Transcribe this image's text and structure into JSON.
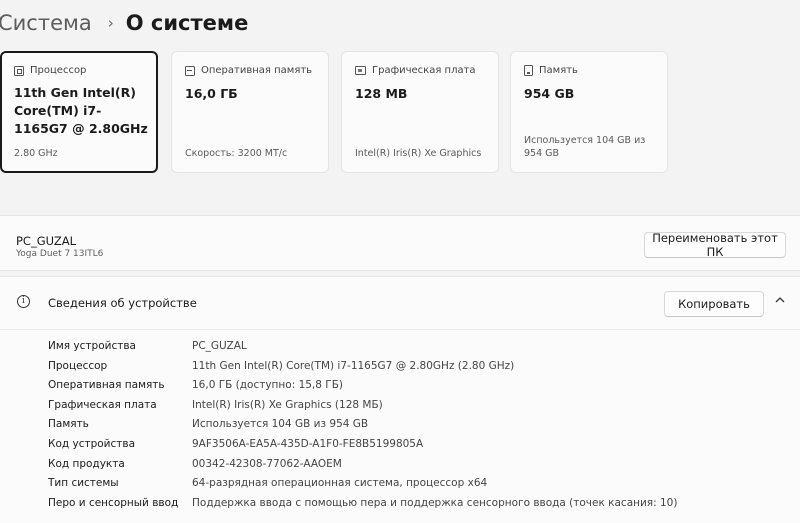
{
  "breadcrumb": {
    "parent": "Система",
    "separator": "›",
    "current": "О системе"
  },
  "cards": [
    {
      "icon": "cpu-icon",
      "title": "Процессор",
      "value": "11th Gen Intel(R) Core(TM) i7-1165G7 @ 2.80GHz",
      "sub": "2.80 GHz"
    },
    {
      "icon": "ram-icon",
      "title": "Оперативная память",
      "value": "16,0 ГБ",
      "sub": "Скорость: 3200 МТ/с"
    },
    {
      "icon": "gpu-icon",
      "title": "Графическая плата",
      "value": "128 MB",
      "sub": "Intel(R) Iris(R) Xe Graphics"
    },
    {
      "icon": "storage-icon",
      "title": "Память",
      "value": "954 GB",
      "sub": "Используется 104 GB из 954 GB"
    }
  ],
  "pc": {
    "name": "PC_GUZAL",
    "model": "Yoga Duet 7 13ITL6",
    "rename_label": "Переименовать этот ПК"
  },
  "device_info": {
    "title": "Сведения об устройстве",
    "copy_label": "Копировать",
    "rows": [
      {
        "key": "Имя устройства",
        "value": "PC_GUZAL"
      },
      {
        "key": "Процессор",
        "value": "11th Gen Intel(R) Core(TM) i7-1165G7 @ 2.80GHz (2.80 GHz)"
      },
      {
        "key": "Оперативная память",
        "value": "16,0 ГБ (доступно: 15,8 ГБ)"
      },
      {
        "key": "Графическая плата",
        "value": "Intel(R) Iris(R) Xe Graphics (128 МБ)"
      },
      {
        "key": "Память",
        "value": "Используется 104 GB из 954 GB"
      },
      {
        "key": "Код устройства",
        "value": "9AF3506A-EA5A-435D-A1F0-FE8B5199805A"
      },
      {
        "key": "Код продукта",
        "value": "00342-42308-77062-AAOEM"
      },
      {
        "key": "Тип системы",
        "value": "64-разрядная операционная система, процессор x64"
      },
      {
        "key": "Перо и сенсорный ввод",
        "value": "Поддержка ввода с помощью пера и поддержка сенсорного ввода (точек касания: 10)"
      }
    ]
  }
}
